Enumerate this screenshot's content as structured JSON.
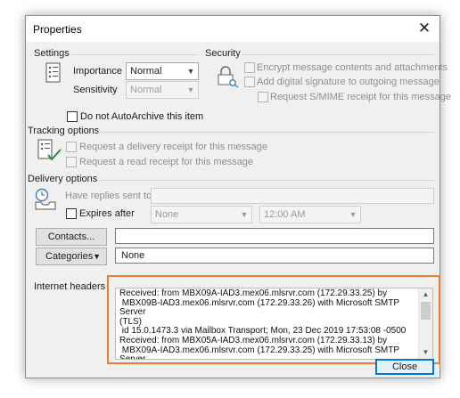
{
  "window": {
    "title": "Properties"
  },
  "settings": {
    "label": "Settings",
    "importance_label": "Importance",
    "importance_value": "Normal",
    "sensitivity_label": "Sensitivity",
    "sensitivity_value": "Normal",
    "autoarchive_label": "Do not AutoArchive this item"
  },
  "security": {
    "label": "Security",
    "encrypt_label": "Encrypt message contents and attachments",
    "signature_label": "Add digital signature to outgoing message",
    "smime_label": "Request S/MIME receipt for this message"
  },
  "tracking": {
    "label": "Tracking options",
    "delivery_receipt_label": "Request a delivery receipt for this message",
    "read_receipt_label": "Request a read receipt for this message"
  },
  "delivery": {
    "label": "Delivery options",
    "replies_label": "Have replies sent to",
    "expires_label": "Expires after",
    "expires_date": "None",
    "expires_time": "12:00 AM"
  },
  "contacts": {
    "button_label": "Contacts...",
    "value": ""
  },
  "categories": {
    "button_label": "Categories",
    "value": "None"
  },
  "internet_headers": {
    "label": "Internet headers",
    "text": "Received: from MBX09A-IAD3.mex06.mlsrvr.com (172.29.33.25) by\n MBX09B-IAD3.mex06.mlsrvr.com (172.29.33.26) with Microsoft SMTP Server\n(TLS)\n id 15.0.1473.3 via Mailbox Transport; Mon, 23 Dec 2019 17:53:08 -0500\nReceived: from MBX05A-IAD3.mex06.mlsrvr.com (172.29.33.13) by\n MBX09A-IAD3.mex06.mlsrvr.com (172.29.33.25) with Microsoft SMTP Server\n(TLS)"
  },
  "footer": {
    "close_label": "Close"
  },
  "colors": {
    "highlight": "#ed7d31",
    "focus": "#0078d7"
  }
}
